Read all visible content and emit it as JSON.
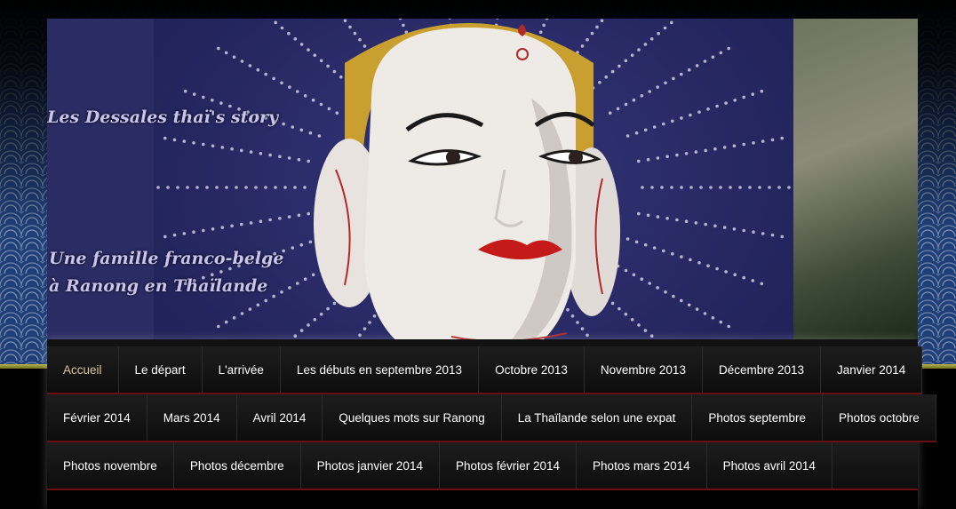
{
  "header": {
    "title": "Les Dessales thaï's story",
    "tagline_line1": "Une famille franco-belge",
    "tagline_line2": "à Ranong en Thaïlande"
  },
  "nav": {
    "rows": [
      [
        "Accueil",
        "Le départ",
        "L'arrivée",
        "Les débuts en septembre 2013",
        "Octobre 2013",
        "Novembre 2013",
        "Décembre 2013",
        "Janvier 2014"
      ],
      [
        "Février 2014",
        "Mars 2014",
        "Avril 2014",
        "Quelques mots sur Ranong",
        "La Thaïlande selon une expat",
        "Photos septembre",
        "Photos octobre"
      ],
      [
        "Photos novembre",
        "Photos décembre",
        "Photos janvier 2014",
        "Photos février 2014",
        "Photos mars 2014",
        "Photos avril 2014"
      ]
    ],
    "active": "Accueil"
  },
  "colors": {
    "nav_text": "#ffffff",
    "nav_active_text": "#d9c8a0",
    "nav_underline": "#6a0f12",
    "title_text": "#c9c4ee"
  }
}
